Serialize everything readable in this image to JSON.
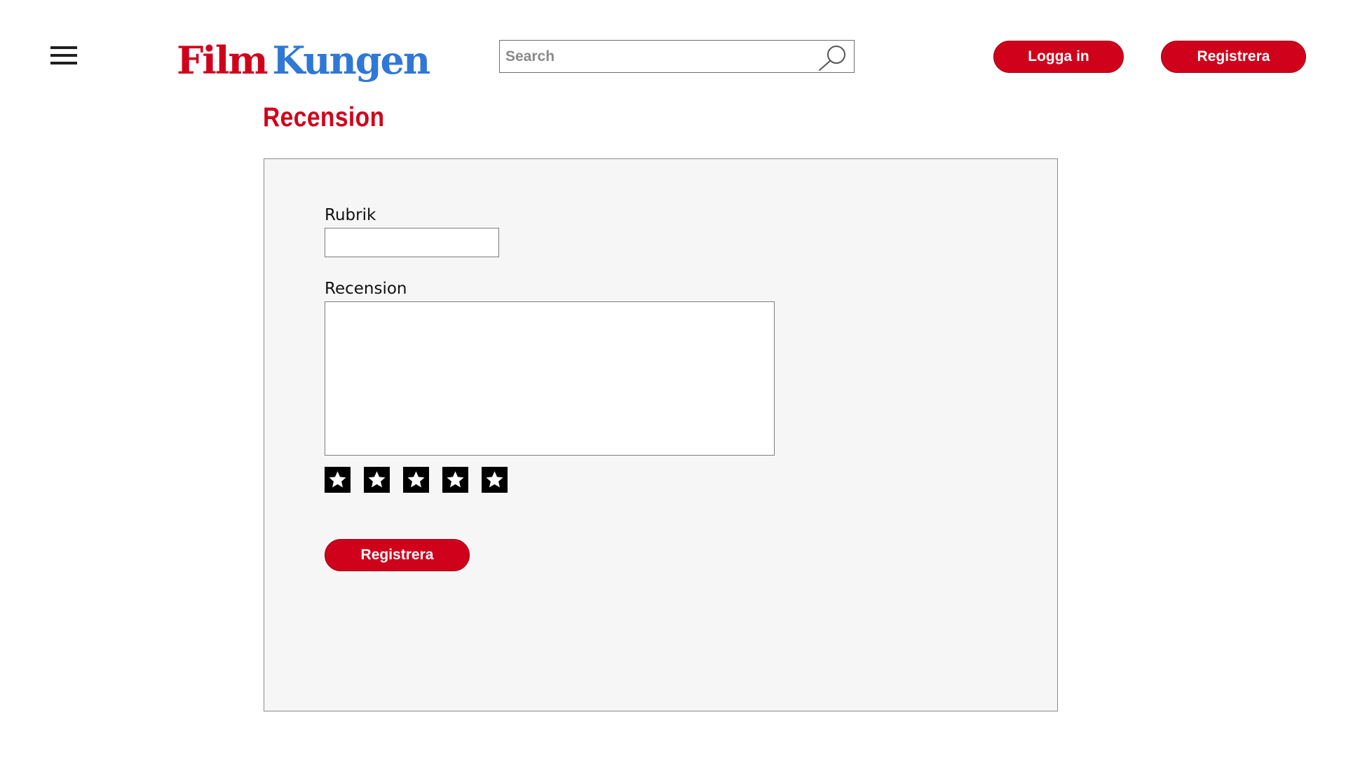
{
  "header": {
    "logo": {
      "part1": "Film",
      "part2": "Kungen"
    },
    "search": {
      "placeholder": "Search",
      "value": ""
    },
    "login_label": "Logga in",
    "register_label": "Registrera",
    "menu_icon": "hamburger-menu-icon",
    "search_icon": "magnifier-icon"
  },
  "page": {
    "title": "Recension"
  },
  "form": {
    "rubrik_label": "Rubrik",
    "rubrik_value": "",
    "recension_label": "Recension",
    "recension_value": "",
    "rating": {
      "max": 5,
      "icon": "star-icon"
    },
    "submit_label": "Registrera"
  },
  "colors": {
    "brand_red": "#d0021b",
    "brand_blue": "#2f78d6",
    "panel_background": "#f6f6f6"
  }
}
